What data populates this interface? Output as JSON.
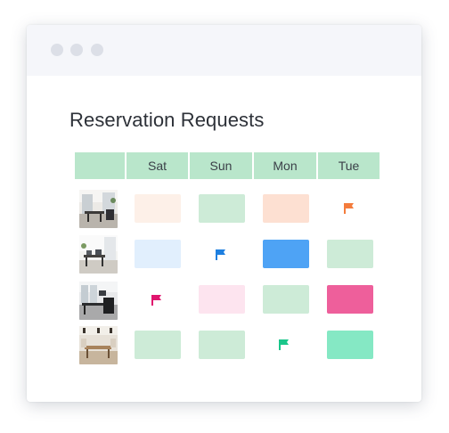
{
  "page": {
    "title": "Reservation Requests"
  },
  "window": {
    "controls": [
      "close-dot",
      "minimize-dot",
      "maximize-dot"
    ]
  },
  "table": {
    "corner_label": "",
    "columns": [
      "Sat",
      "Sun",
      "Mon",
      "Tue"
    ],
    "rows": [
      {
        "room_photo_icon": "office-room-photo-1",
        "cells": [
          {
            "kind": "block",
            "color": "#fdf0e8"
          },
          {
            "kind": "block",
            "color": "#cdebd7"
          },
          {
            "kind": "block",
            "color": "#fde0d2"
          },
          {
            "kind": "flag",
            "color": "#f47c3c"
          }
        ]
      },
      {
        "room_photo_icon": "office-room-photo-2",
        "cells": [
          {
            "kind": "block",
            "color": "#e1effd"
          },
          {
            "kind": "flag",
            "color": "#1e7fe0"
          },
          {
            "kind": "block",
            "color": "#4ea3f5"
          },
          {
            "kind": "block",
            "color": "#cdebd7"
          }
        ]
      },
      {
        "room_photo_icon": "office-room-photo-3",
        "cells": [
          {
            "kind": "flag",
            "color": "#e0156e"
          },
          {
            "kind": "block",
            "color": "#fde4ef"
          },
          {
            "kind": "block",
            "color": "#cdebd7"
          },
          {
            "kind": "block",
            "color": "#ee5f9b"
          }
        ]
      },
      {
        "room_photo_icon": "office-room-photo-4",
        "cells": [
          {
            "kind": "block",
            "color": "#cdebd7"
          },
          {
            "kind": "block",
            "color": "#cdebd7"
          },
          {
            "kind": "flag",
            "color": "#19c68a"
          },
          {
            "kind": "block",
            "color": "#85e8c4"
          }
        ]
      }
    ]
  },
  "colors": {
    "header_bg": "#b9e6cb",
    "titlebar_bg": "#f5f6fa",
    "dot": "#dcdfe7"
  }
}
